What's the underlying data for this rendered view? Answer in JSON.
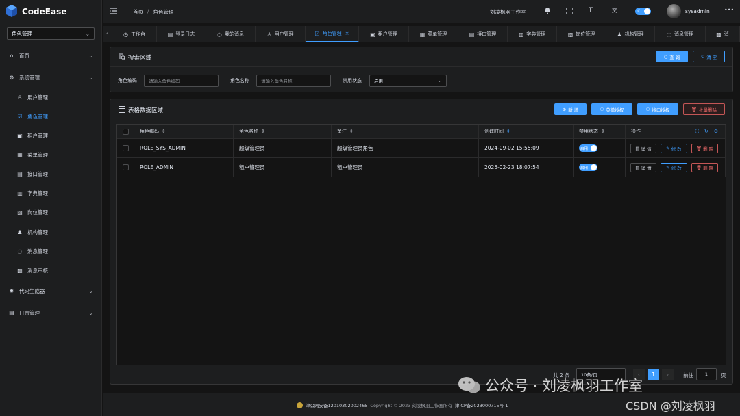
{
  "app": {
    "name": "CodeEase"
  },
  "sidebar": {
    "select_value": "角色管理",
    "items": [
      {
        "label": "首页",
        "icon": "home-icon",
        "level": 1,
        "chevron": true
      },
      {
        "label": "系统管理",
        "icon": "gear-icon",
        "level": 1,
        "chevron": true
      },
      {
        "label": "用户管理",
        "icon": "user-icon",
        "level": 2
      },
      {
        "label": "角色管理",
        "icon": "role-icon",
        "level": 2,
        "active": true
      },
      {
        "label": "租户管理",
        "icon": "tenant-icon",
        "level": 2
      },
      {
        "label": "菜单管理",
        "icon": "menu-icon",
        "level": 2
      },
      {
        "label": "接口管理",
        "icon": "api-icon",
        "level": 2
      },
      {
        "label": "字典管理",
        "icon": "dict-icon",
        "level": 2
      },
      {
        "label": "岗位管理",
        "icon": "post-icon",
        "level": 2
      },
      {
        "label": "机构管理",
        "icon": "org-icon",
        "level": 2
      },
      {
        "label": "消息管理",
        "icon": "message-icon",
        "level": 2
      },
      {
        "label": "消息审核",
        "icon": "audit-icon",
        "level": 2
      },
      {
        "label": "代码生成器",
        "icon": "codegen-icon",
        "level": 1,
        "chevron": true
      },
      {
        "label": "日志管理",
        "icon": "log-icon",
        "level": 1,
        "chevron": true
      }
    ]
  },
  "header": {
    "breadcrumb": [
      "首页",
      "角色管理"
    ],
    "breadcrumb_sep": "/",
    "studio": "刘凌枫羽工作室",
    "username": "sysadmin",
    "more": "•••"
  },
  "tabs": [
    {
      "label": "工作台",
      "icon": "dashboard-icon"
    },
    {
      "label": "登录日志",
      "icon": "log-icon"
    },
    {
      "label": "我的消息",
      "icon": "message-icon"
    },
    {
      "label": "用户管理",
      "icon": "user-icon"
    },
    {
      "label": "角色管理",
      "icon": "role-icon",
      "active": true,
      "close": "×"
    },
    {
      "label": "租户管理",
      "icon": "tenant-icon"
    },
    {
      "label": "菜单管理",
      "icon": "menu-icon"
    },
    {
      "label": "接口管理",
      "icon": "api-icon"
    },
    {
      "label": "字典管理",
      "icon": "dict-icon"
    },
    {
      "label": "岗位管理",
      "icon": "post-icon"
    },
    {
      "label": "机构管理",
      "icon": "org-icon"
    },
    {
      "label": "消息管理",
      "icon": "message-icon"
    },
    {
      "label": "消",
      "icon": "audit-icon"
    }
  ],
  "search": {
    "title": "搜索区域",
    "query_label": "查 询",
    "reset_label": "清 空",
    "code_label": "角色编码",
    "code_placeholder": "请输入角色编码",
    "name_label": "角色名称",
    "name_placeholder": "请输入角色名称",
    "status_label": "禁用状态",
    "status_value": "启用"
  },
  "table_area": {
    "title": "表格数据区域",
    "add_label": "新 增",
    "menu_auth_label": "菜单授权",
    "api_auth_label": "接口授权",
    "batch_delete_label": "批量删除"
  },
  "table": {
    "headers": [
      "角色编码",
      "角色名称",
      "备注",
      "创建时间",
      "禁用状态",
      "操作"
    ],
    "rows": [
      {
        "code": "ROLE_SYS_ADMIN",
        "name": "超级管理员",
        "remark": "超级管理员角色",
        "created": "2024-09-02 15:55:09",
        "status": "启用"
      },
      {
        "code": "ROLE_ADMIN",
        "name": "租户管理员",
        "remark": "租户管理员",
        "created": "2025-02-23 18:07:54",
        "status": "启用"
      }
    ],
    "detail_label": "详 情",
    "edit_label": "修 改",
    "delete_label": "删 除"
  },
  "pagination": {
    "total": "共 2 条",
    "page_size": "10条/页",
    "current_page": "1",
    "goto_label": "前往",
    "goto_value": "1",
    "page_unit": "页"
  },
  "footer": {
    "beian": "津公网安备12010302002465",
    "copyright": "Copyright © 2023 刘凌枫羽工作室所有",
    "icp": "津ICP备2023000715号-1"
  },
  "watermark": {
    "wechat": "公众号 · 刘凌枫羽工作室",
    "csdn": "CSDN @刘凌枫羽"
  },
  "colors": {
    "accent": "#409eff",
    "danger": "#f56c6c",
    "bg": "#141414",
    "panel": "#1d1e1f"
  }
}
